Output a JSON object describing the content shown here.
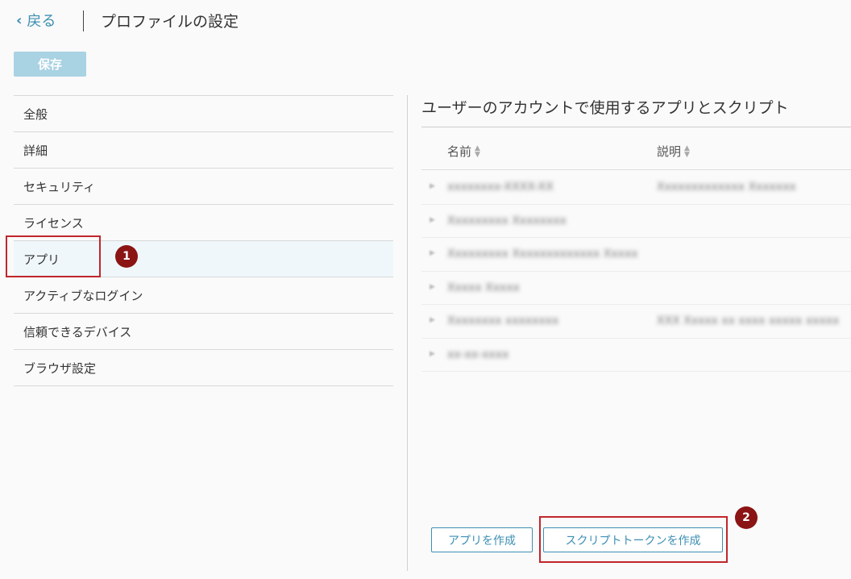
{
  "header": {
    "back_label": "戻る",
    "title": "プロファイルの設定"
  },
  "toolbar": {
    "save_label": "保存"
  },
  "nav": {
    "items": [
      {
        "label": "全般"
      },
      {
        "label": "詳細"
      },
      {
        "label": "セキュリティ"
      },
      {
        "label": "ライセンス"
      },
      {
        "label": "アプリ",
        "active": true
      },
      {
        "label": "アクティブなログイン"
      },
      {
        "label": "信頼できるデバイス"
      },
      {
        "label": "ブラウザ設定"
      }
    ]
  },
  "annotations": {
    "step1": "1",
    "step2": "2",
    "highlight_color": "#c0262c",
    "badge_color": "#8b1414"
  },
  "main": {
    "section_title": "ユーザーのアカウントで使用するアプリとスクリプト",
    "columns": {
      "name": "名前",
      "description": "説明"
    },
    "rows": [
      {
        "name": "xxxxxxxx-XXXX-XX",
        "description": "Xxxxxxxxxxxxx Xxxxxxx"
      },
      {
        "name": "Xxxxxxxxx Xxxxxxxx",
        "description": ""
      },
      {
        "name": "Xxxxxxxxx Xxxxxxxxxxxxx Xxxxx",
        "description": ""
      },
      {
        "name": "Xxxxx Xxxxx",
        "description": ""
      },
      {
        "name": "Xxxxxxxx xxxxxxxx",
        "description": "XXX Xxxxx xx xxxx xxxxx xxxxx"
      },
      {
        "name": "xx-xx-xxxx",
        "description": ""
      }
    ],
    "create_app_label": "アプリを作成",
    "create_token_label": "スクリプトトークンを作成"
  },
  "colors": {
    "accent": "#3d8fb3",
    "save_button": "#a9d2e3",
    "active_row": "#eff7fb"
  }
}
